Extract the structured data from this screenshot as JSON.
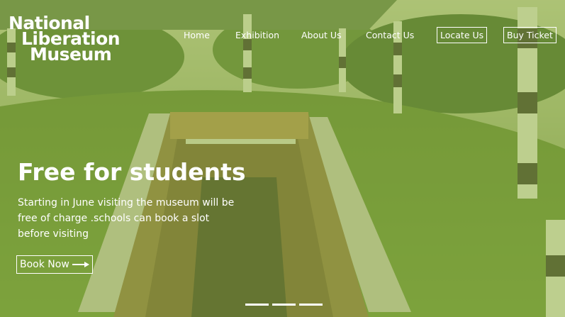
{
  "brand": {
    "line1": "National",
    "line2": "Liberation",
    "line3": "Museum"
  },
  "nav": {
    "items": [
      {
        "label": "Home"
      },
      {
        "label": "Exhibition"
      },
      {
        "label": "About Us"
      },
      {
        "label": "Contact Us"
      }
    ],
    "locate_label": "Locate Us",
    "ticket_label": "Buy Ticket"
  },
  "hero": {
    "headline": "Free for students",
    "description": "Starting in June visiting the museum will be free of charge .schools can book a slot before visiting",
    "cta_label": "Book Now",
    "cta_icon": "arrow-right-icon",
    "slides": 3
  },
  "colors": {
    "overlay": "#96b246",
    "text": "#ffffff"
  }
}
